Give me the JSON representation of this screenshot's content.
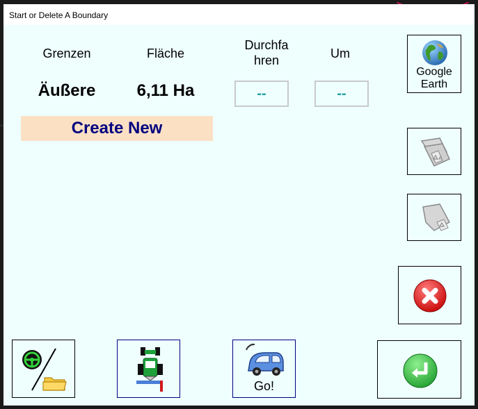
{
  "window": {
    "title": "Start or Delete A Boundary"
  },
  "headers": {
    "boundary": "Grenzen",
    "area": "Fläche",
    "drive_through_line1": "Durchfa",
    "drive_through_line2": "hren",
    "around": "Um"
  },
  "row": {
    "boundary": "Äußere",
    "area": "6,11 Ha",
    "drive_through": "--",
    "around": "--"
  },
  "create_new": "Create New",
  "google_earth": {
    "line1": "Google",
    "line2": "Earth"
  },
  "go_label": "Go!",
  "icons": {
    "google_earth": "globe-icon",
    "delete_all": "recycle-stack-icon",
    "delete_one": "recycle-sheet-icon",
    "cancel": "red-x-icon",
    "ok": "green-return-icon",
    "steer_folder": "steering-wheel-folder-icon",
    "tractor": "tractor-icon",
    "drive": "car-go-icon"
  },
  "colors": {
    "panel": "#eefffe",
    "create_bg": "#fbe0c4",
    "create_text": "#000080",
    "dash_text": "#20a0a0"
  }
}
